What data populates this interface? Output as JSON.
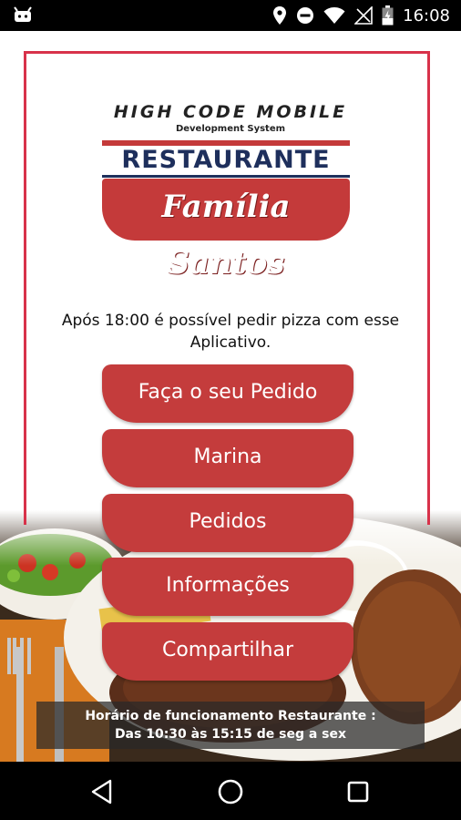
{
  "status_bar": {
    "time": "16:08",
    "icons": [
      "android-notification-icon",
      "location-icon",
      "do-not-disturb-icon",
      "wifi-icon",
      "no-signal-icon",
      "battery-charging-icon"
    ]
  },
  "logo": {
    "brand": "HIGH CODE MOBILE",
    "tagline": "Development System",
    "title": "RESTAURANTE",
    "name": "Família Santos"
  },
  "notice": "Após 18:00 é possível pedir pizza com esse Aplicativo.",
  "menu": [
    {
      "label": "Faça o seu Pedido"
    },
    {
      "label": "Marina"
    },
    {
      "label": "Pedidos"
    },
    {
      "label": "Informações"
    },
    {
      "label": "Compartilhar"
    }
  ],
  "hours": {
    "line1": "Horário de funcionamento Restaurante :",
    "line2": "Das 10:30 às 15:15 de seg a sex"
  },
  "nav": {
    "icons": [
      "back-icon",
      "home-icon",
      "recents-icon"
    ]
  },
  "colors": {
    "accent_red": "#c43c3c",
    "frame_red": "#d8324a",
    "title_navy": "#1e2f5c"
  }
}
